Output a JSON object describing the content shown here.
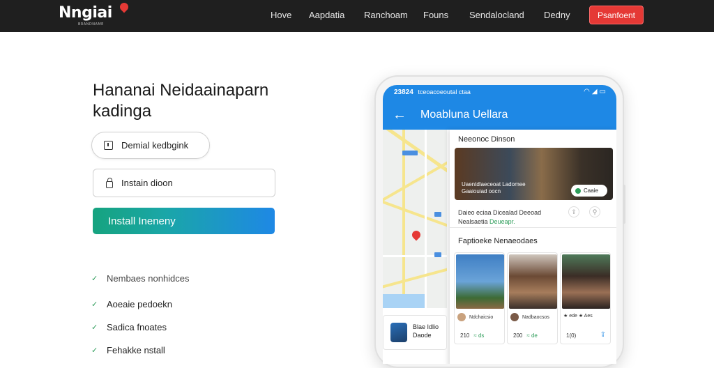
{
  "header": {
    "logo": "Nngiai",
    "logo_tagline": "BRANDNAME",
    "nav": [
      "Hove",
      "Aapdatia",
      "Ranchoam",
      "Founs",
      "Sendalocland",
      "Dedny"
    ],
    "cta": "Psanfoent"
  },
  "hero": {
    "title_line1": "Hananai Neidaainaparn",
    "title_line2": "kadinga",
    "pill_label": "Demial kedbgink",
    "field_placeholder": "Instain dioon",
    "install_button": "Install Ineneny",
    "features": [
      "Nembaes nonhidces",
      "Aoeaie pedoekn",
      "Sadica fnoates",
      "Fehakke nstall"
    ]
  },
  "phone": {
    "status_time": "23824",
    "status_text": "tceoacoeoutal ctaa",
    "status_icons": "wifi signal battery",
    "appbar_title": "Moabluna Uellara",
    "panel_heading": "Neeonoc Dinson",
    "featured_caption_1": "Uaentdlaeceoat Ladomee",
    "featured_caption_2": "Gaaiouiad oocn",
    "featured_badge": "Caaie",
    "meta_line1": "Daieo eciaa Dicealad Deeoad",
    "meta_line2_a": "Nealsaetia",
    "meta_line2_b": "Deueapr.",
    "section_title": "Faptioeke Nenaeodaes",
    "cards": [
      {
        "author": "Ndchaicsio",
        "views": "210",
        "extra": "≈ ds"
      },
      {
        "author": "Nadbaocsos",
        "views": "200",
        "extra": "≈ de"
      },
      {
        "author": "★ ede ★ Aes",
        "views": "1(0)",
        "extra": ""
      }
    ],
    "bottom_card_line1": "Blae Idlio",
    "bottom_card_line2": "Daode"
  },
  "colors": {
    "topbar": "#1f1f1f",
    "cta_red": "#e53935",
    "app_blue": "#1e88e5",
    "install_gradient_start": "#16a37f",
    "install_gradient_end": "#1e88e5",
    "check_green": "#2e9d5a"
  }
}
